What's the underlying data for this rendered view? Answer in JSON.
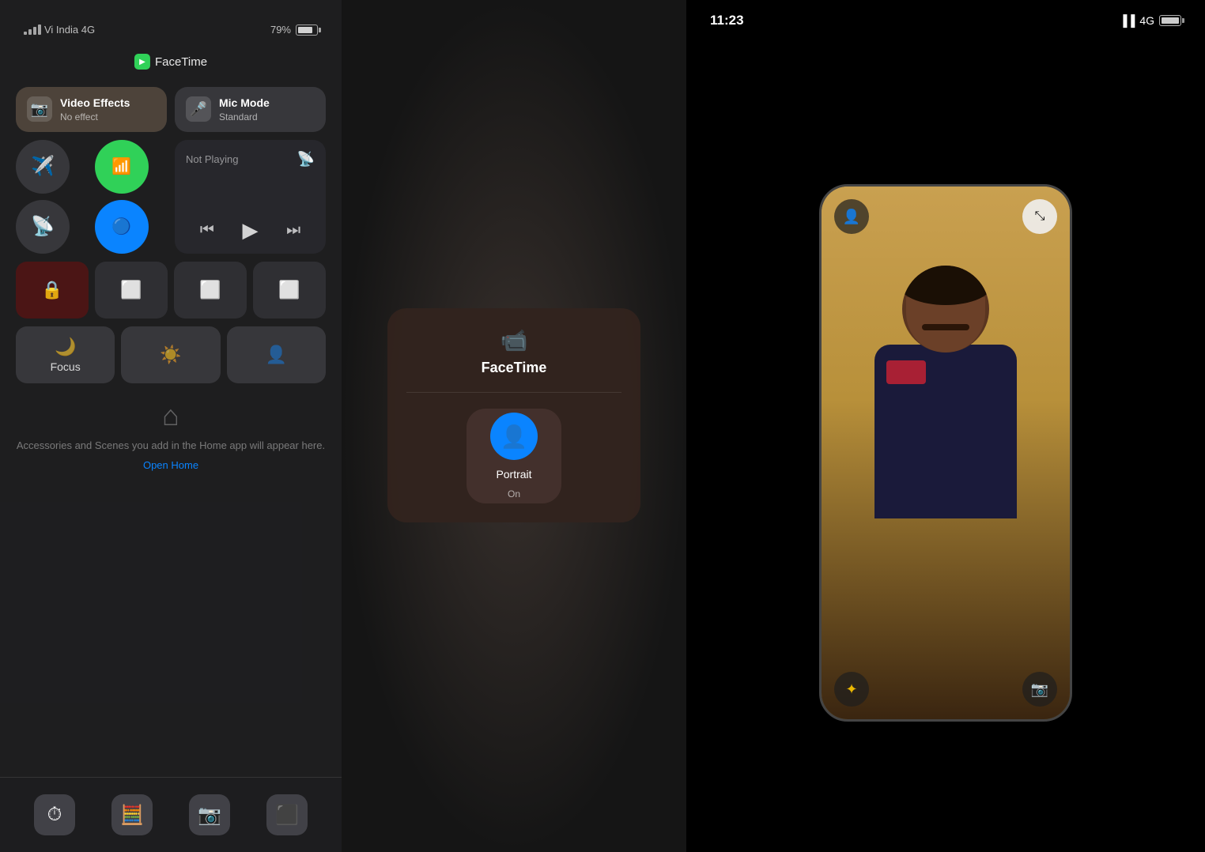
{
  "left_panel": {
    "status": {
      "carrier": "Vi India 4G",
      "battery": "79%",
      "battery_percent": 79
    },
    "facetime_label": "FaceTime",
    "video_effects": {
      "title": "Video Effects",
      "subtitle": "No effect"
    },
    "mic_mode": {
      "title": "Mic Mode",
      "subtitle": "Standard"
    },
    "now_playing": "Not Playing",
    "focus_label": "Focus",
    "home_text": "Accessories and Scenes you add in the Home app will appear here.",
    "home_link": "Open Home"
  },
  "center_panel": {
    "popup_title": "FaceTime",
    "portrait_label": "Portrait",
    "portrait_status": "On"
  },
  "right_panel": {
    "time": "11:23",
    "network": "4G"
  }
}
